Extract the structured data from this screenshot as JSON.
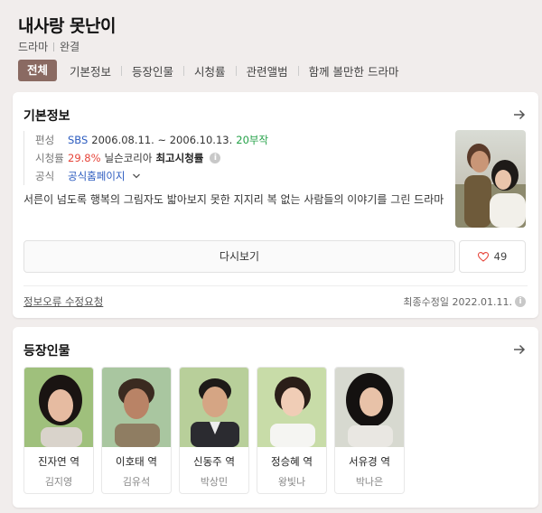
{
  "header": {
    "title": "내사랑 못난이",
    "genre": "드라마",
    "status": "완결"
  },
  "tabs": [
    {
      "label": "전체",
      "active": true
    },
    {
      "label": "기본정보"
    },
    {
      "label": "등장인물"
    },
    {
      "label": "시청률"
    },
    {
      "label": "관련앨범"
    },
    {
      "label": "함께 볼만한 드라마"
    }
  ],
  "basic": {
    "title": "기본정보",
    "broadcast_label": "편성",
    "channel": "SBS",
    "period": "2006.08.11. ~ 2006.10.13.",
    "episodes": "20부작",
    "rating_label": "시청률",
    "rating": "29.8%",
    "rating_source": "닐슨코리아",
    "rating_type": "최고시청률",
    "official_label": "공식",
    "official_link": "공식홈페이지",
    "description": "서른이 넘도록 행복의 그림자도 밟아보지 못한 지지리 복 없는 사람들의 이야기를 그린 드라마",
    "rewatch": "다시보기",
    "likes": "49",
    "report": "정보오류 수정요청",
    "updated": "최종수정일 2022.01.11."
  },
  "cast_section": {
    "title": "등장인물",
    "people": [
      {
        "role": "진자연 역",
        "actor": "김지영"
      },
      {
        "role": "이호태 역",
        "actor": "김유석"
      },
      {
        "role": "신동주 역",
        "actor": "박상민"
      },
      {
        "role": "정승혜 역",
        "actor": "왕빛나"
      },
      {
        "role": "서유경 역",
        "actor": "박나은"
      }
    ]
  },
  "colors": {
    "tab_active": "#8a6a62",
    "link": "#2b5bbf",
    "episodes": "#24a148",
    "rating": "#e6453a"
  }
}
